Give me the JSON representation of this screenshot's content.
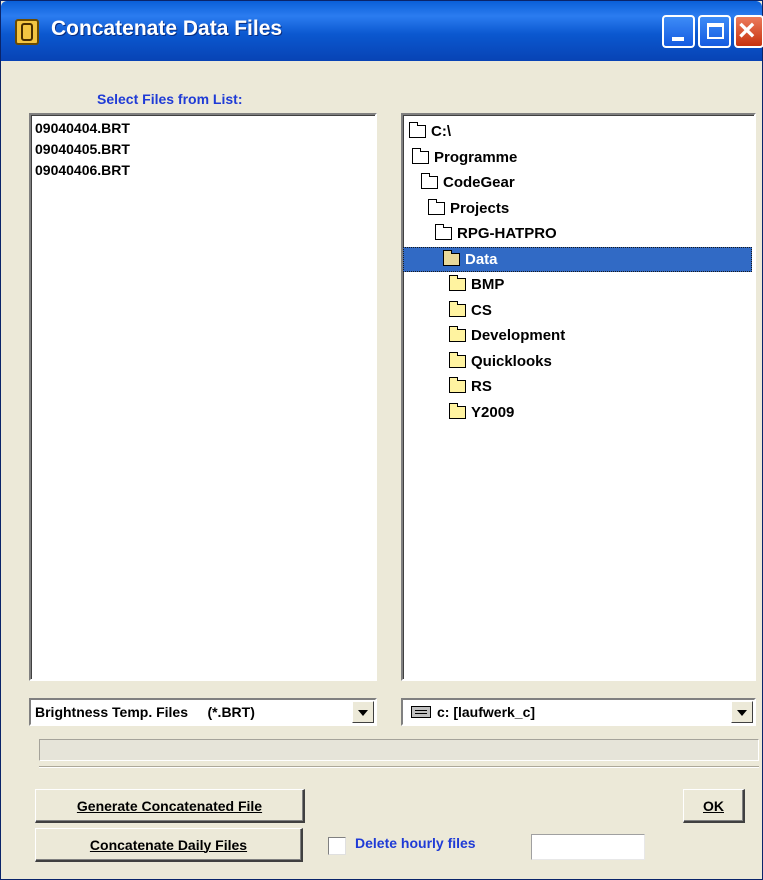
{
  "window": {
    "title": "Concatenate Data Files"
  },
  "file_panel": {
    "label": "Select Files from List:",
    "files": [
      "09040404.BRT",
      "09040405.BRT",
      "09040406.BRT"
    ],
    "filter": {
      "selected": "Brightness Temp. Files     (*.BRT)"
    }
  },
  "dir_panel": {
    "tree": [
      {
        "name": "C:\\",
        "icon": "folder-open-icon"
      },
      {
        "name": "Programme",
        "icon": "folder-open-icon"
      },
      {
        "name": "CodeGear",
        "icon": "folder-open-icon"
      },
      {
        "name": "Projects",
        "icon": "folder-open-icon"
      },
      {
        "name": "RPG-HATPRO",
        "icon": "folder-open-icon"
      },
      {
        "name": "Data",
        "icon": "folder-open-icon",
        "selected": true
      },
      {
        "name": "BMP",
        "icon": "folder-closed-icon"
      },
      {
        "name": "CS",
        "icon": "folder-closed-icon"
      },
      {
        "name": "Development",
        "icon": "folder-closed-icon"
      },
      {
        "name": "Quicklooks",
        "icon": "folder-closed-icon"
      },
      {
        "name": "RS",
        "icon": "folder-closed-icon"
      },
      {
        "name": "Y2009",
        "icon": "folder-closed-icon"
      }
    ],
    "drive": {
      "selected": "c: [laufwerk_c]"
    }
  },
  "progress": {
    "value": 0
  },
  "buttons": {
    "generate": "Generate Concatenated File",
    "concat_daily": "Concatenate Daily Files",
    "ok": "OK"
  },
  "delete_hourly": {
    "label": "Delete hourly files",
    "checked": false,
    "input_value": ""
  },
  "colors": {
    "label_blue": "#1f3bd6",
    "selection": "#316ac5",
    "titlebar": "#0a5fd8"
  }
}
